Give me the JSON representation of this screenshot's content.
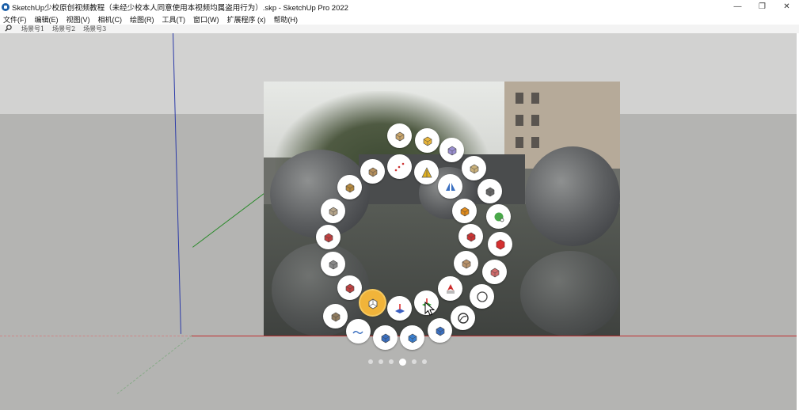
{
  "window": {
    "title": "SketchUp少校原创视频教程（未经少校本人同意使用本视频均属盗用行为）.skp - SketchUp Pro 2022",
    "minimize_glyph": "—",
    "maximize_glyph": "❐",
    "close_glyph": "✕"
  },
  "menu": [
    {
      "label": "文件(F)"
    },
    {
      "label": "编辑(E)"
    },
    {
      "label": "视图(V)"
    },
    {
      "label": "相机(C)"
    },
    {
      "label": "绘图(R)"
    },
    {
      "label": "工具(T)"
    },
    {
      "label": "窗口(W)"
    },
    {
      "label": "扩展程序 (x)"
    },
    {
      "label": "帮助(H)"
    }
  ],
  "scenes": {
    "search_icon": "search-icon",
    "tabs": [
      {
        "label": "场景号1"
      },
      {
        "label": "场景号2"
      },
      {
        "label": "场景号3"
      }
    ]
  },
  "colors": {
    "accent_active": "#f1b43a",
    "axis_red": "#c03030",
    "axis_green": "#2a8a2a",
    "axis_blue": "#2b3aa8",
    "viewport_ground": "#b4b4b2",
    "viewport_sky": "#d2d2d1"
  },
  "radial_menu": {
    "active_tool": "push-pull-tool",
    "page_count": 6,
    "current_page": 4,
    "tools": [
      {
        "icon": "shape-bender-icon",
        "color": "#c9a56b"
      },
      {
        "icon": "yellow-cube-icon",
        "color": "#e8b53a"
      },
      {
        "icon": "purple-solid-icon",
        "color": "#9a8fd0"
      },
      {
        "icon": "fold-cube-icon",
        "color": "#c9b07a"
      },
      {
        "icon": "z-shape-icon",
        "color": "#b58f5c"
      },
      {
        "icon": "point-curve-icon",
        "color": "#cc3333"
      },
      {
        "icon": "triangle-icon",
        "color": "#e0b020"
      },
      {
        "icon": "mirror-icon",
        "color": "#3a6fc0"
      },
      {
        "icon": "cube-outline-icon",
        "color": "#666666"
      },
      {
        "icon": "bend-icon",
        "color": "#b5883e"
      },
      {
        "icon": "curve-icon",
        "color": "#e08a1a"
      },
      {
        "icon": "green-sphere-icon",
        "color": "#4aa84a"
      },
      {
        "icon": "twist-icon",
        "color": "#b5a48a"
      },
      {
        "icon": "red-arrow-up-icon",
        "color": "#cc3333"
      },
      {
        "icon": "red-cube-icon",
        "color": "#d43030"
      },
      {
        "icon": "move-red-icon",
        "color": "#c04040"
      },
      {
        "icon": "taper-icon",
        "color": "#b8926a"
      },
      {
        "icon": "offset-icon",
        "color": "#d06a6a"
      },
      {
        "icon": "cube-grey-icon",
        "color": "#888888"
      },
      {
        "icon": "north-arrow-icon",
        "color": "#cc2a2a"
      },
      {
        "icon": "circle-icon",
        "color": "#444444"
      },
      {
        "icon": "stack-icon",
        "color": "#c04040"
      },
      {
        "icon": "green-plane-icon",
        "color": "#3aa83a"
      },
      {
        "icon": "push-pull-icon",
        "color": "#555555"
      },
      {
        "icon": "blue-plane-icon",
        "color": "#3a5fc0"
      },
      {
        "icon": "arc-circle-icon",
        "color": "#333333"
      },
      {
        "icon": "follow-icon",
        "color": "#8f7b5f"
      },
      {
        "icon": "wave-icon",
        "color": "#3a6fc0"
      },
      {
        "icon": "blue-cubes-icon",
        "color": "#3a6fc0"
      },
      {
        "icon": "blue-cubes-small-icon",
        "color": "#3a7fd0"
      },
      {
        "icon": "blue-box-icon",
        "color": "#3a6fc0"
      },
      {
        "icon": "arch-icon",
        "color": "#555555"
      }
    ]
  }
}
